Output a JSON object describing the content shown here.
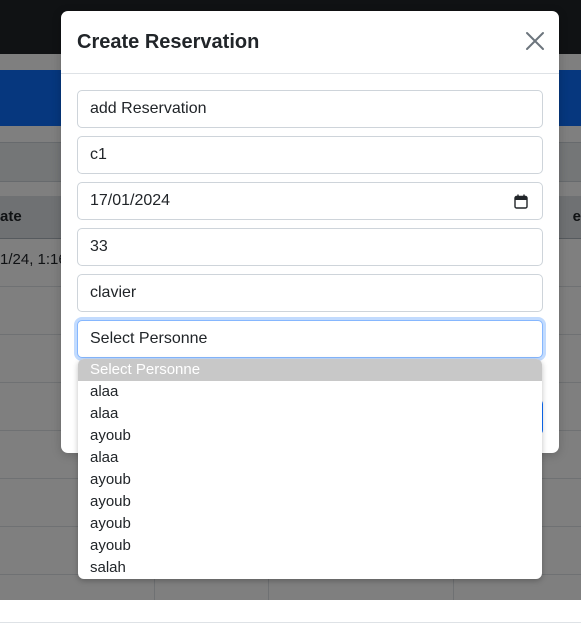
{
  "background": {
    "table_header_left": "ate",
    "table_header_right": "e",
    "row_1_cell": "1/24, 1:16"
  },
  "modal": {
    "title": "Create Reservation",
    "close_icon": "close-icon",
    "fields": {
      "name": "add Reservation",
      "code": "c1",
      "date": "17/01/2024",
      "number": "33",
      "item": "clavier",
      "person_select": "Select Personne"
    }
  },
  "dropdown": {
    "options": [
      "Select Personne",
      "alaa",
      "alaa",
      "ayoub",
      "alaa",
      "ayoub",
      "ayoub",
      "ayoub",
      "ayoub",
      "salah"
    ],
    "selected_index": 0
  },
  "colors": {
    "primary": "#0d6efd",
    "focus_border": "#86b7fe",
    "selected_option_bg": "#c8c8c8"
  }
}
